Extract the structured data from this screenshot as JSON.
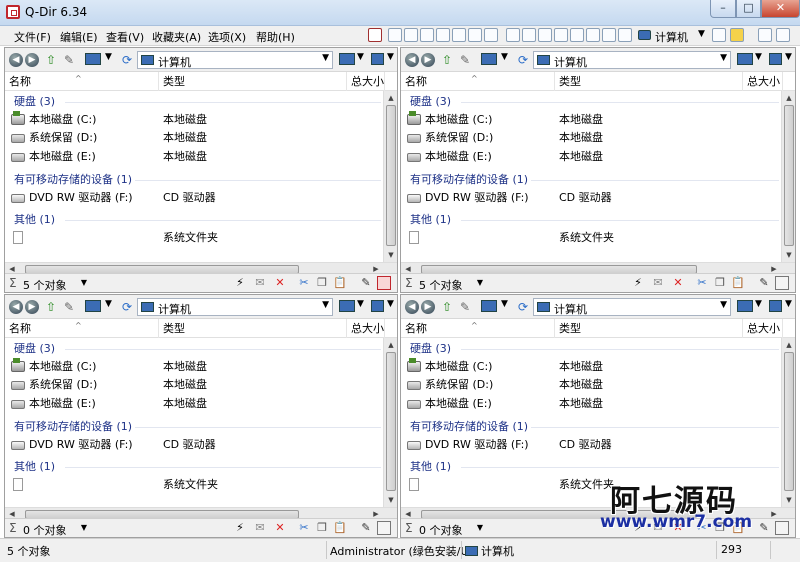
{
  "window": {
    "title": "Q-Dir 6.34",
    "minimize": "–",
    "maximize": "□",
    "close": "✕"
  },
  "menu": [
    "文件(F)",
    "编辑(E)",
    "查看(V)",
    "收藏夹(A)",
    "选项(X)",
    "帮助(H)"
  ],
  "toolbar": {
    "computer_label": "计算机"
  },
  "pane_template": {
    "address": "计算机",
    "columns": {
      "name": "名称",
      "type": "类型",
      "size": "总大小"
    }
  },
  "panes": [
    {
      "address": "计算机",
      "columns": {
        "name": "名称",
        "type": "类型",
        "size": "总大小"
      },
      "groups": [
        {
          "label": "硬盘 (3)",
          "items": [
            {
              "name": "本地磁盘 (C:)",
              "type": "本地磁盘",
              "icon": "windows-drive-icon"
            },
            {
              "name": "系统保留 (D:)",
              "type": "本地磁盘",
              "icon": "drive-icon"
            },
            {
              "name": "本地磁盘 (E:)",
              "type": "本地磁盘",
              "icon": "drive-icon"
            }
          ]
        },
        {
          "label": "有可移动存储的设备 (1)",
          "items": [
            {
              "name": "DVD RW 驱动器 (F:)",
              "type": "CD 驱动器",
              "icon": "dvd-drive-icon"
            }
          ]
        },
        {
          "label": "其他 (1)",
          "items": [
            {
              "name": "",
              "type": "系统文件夹",
              "icon": "file-icon"
            }
          ]
        }
      ],
      "status": "5 个对象"
    },
    {
      "address": "计算机",
      "columns": {
        "name": "名称",
        "type": "类型",
        "size": "总大小"
      },
      "groups": [
        {
          "label": "硬盘 (3)",
          "items": [
            {
              "name": "本地磁盘 (C:)",
              "type": "本地磁盘",
              "icon": "windows-drive-icon"
            },
            {
              "name": "系统保留 (D:)",
              "type": "本地磁盘",
              "icon": "drive-icon"
            },
            {
              "name": "本地磁盘 (E:)",
              "type": "本地磁盘",
              "icon": "drive-icon"
            }
          ]
        },
        {
          "label": "有可移动存储的设备 (1)",
          "items": [
            {
              "name": "DVD RW 驱动器 (F:)",
              "type": "CD 驱动器",
              "icon": "dvd-drive-icon"
            }
          ]
        },
        {
          "label": "其他 (1)",
          "items": [
            {
              "name": "",
              "type": "系统文件夹",
              "icon": "file-icon"
            }
          ]
        }
      ],
      "status": "5 个对象"
    },
    {
      "address": "计算机",
      "columns": {
        "name": "名称",
        "type": "类型",
        "size": "总大小"
      },
      "groups": [
        {
          "label": "硬盘 (3)",
          "items": [
            {
              "name": "本地磁盘 (C:)",
              "type": "本地磁盘",
              "icon": "windows-drive-icon"
            },
            {
              "name": "系统保留 (D:)",
              "type": "本地磁盘",
              "icon": "drive-icon"
            },
            {
              "name": "本地磁盘 (E:)",
              "type": "本地磁盘",
              "icon": "drive-icon"
            }
          ]
        },
        {
          "label": "有可移动存储的设备 (1)",
          "items": [
            {
              "name": "DVD RW 驱动器 (F:)",
              "type": "CD 驱动器",
              "icon": "dvd-drive-icon"
            }
          ]
        },
        {
          "label": "其他 (1)",
          "items": [
            {
              "name": "",
              "type": "系统文件夹",
              "icon": "file-icon"
            }
          ]
        }
      ],
      "status": "0 个对象"
    },
    {
      "address": "计算机",
      "columns": {
        "name": "名称",
        "type": "类型",
        "size": "总大小"
      },
      "groups": [
        {
          "label": "硬盘 (3)",
          "items": [
            {
              "name": "本地磁盘 (C:)",
              "type": "本地磁盘",
              "icon": "windows-drive-icon"
            },
            {
              "name": "系统保留 (D:)",
              "type": "本地磁盘",
              "icon": "drive-icon"
            },
            {
              "name": "本地磁盘 (E:)",
              "type": "本地磁盘",
              "icon": "drive-icon"
            }
          ]
        },
        {
          "label": "有可移动存储的设备 (1)",
          "items": [
            {
              "name": "DVD RW 驱动器 (F:)",
              "type": "CD 驱动器",
              "icon": "dvd-drive-icon"
            }
          ]
        },
        {
          "label": "其他 (1)",
          "items": [
            {
              "name": "",
              "type": "系统文件夹",
              "icon": "file-icon"
            }
          ]
        }
      ],
      "status": "0 个对象"
    }
  ],
  "statusbar": {
    "objects": "5 个对象",
    "user": "Administrator (绿色安装/Un",
    "location": "计算机",
    "number": "293"
  },
  "watermark": {
    "text": "阿七源码",
    "url": "www.wmr7.com"
  },
  "colors": {
    "group_text": "#1e3287",
    "close_red": "#c7452f",
    "title_bg": "#c5d9f0"
  }
}
